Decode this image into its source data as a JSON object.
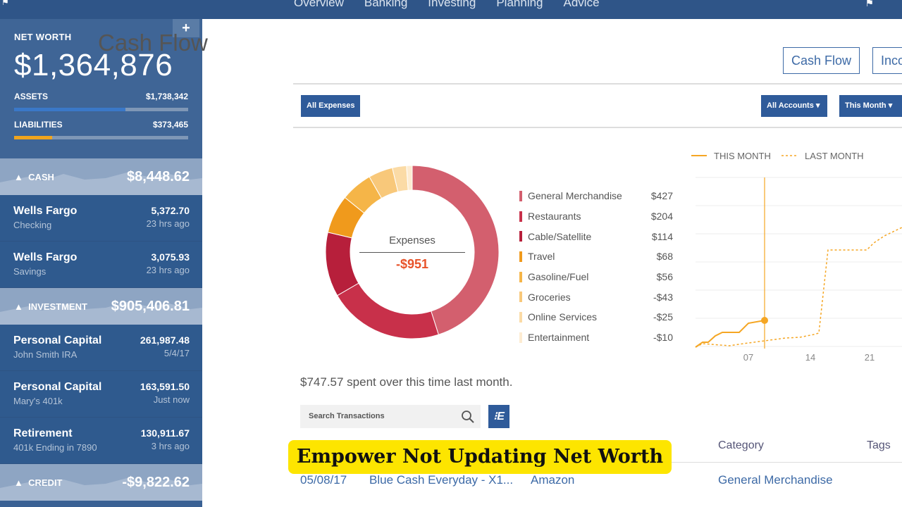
{
  "topnav": {
    "items": [
      "Overview",
      "Banking",
      "Investing",
      "Planning",
      "Advice"
    ]
  },
  "sidebar": {
    "net_worth_label": "NET WORTH",
    "net_worth": "$1,364,876",
    "assets_label": "ASSETS",
    "assets": "$1,738,342",
    "assets_fill": 0.64,
    "liabilities_label": "LIABILITIES",
    "liabilities": "$373,465",
    "liabilities_fill": 0.22,
    "sections": [
      {
        "title": "CASH",
        "total": "$8,448.62",
        "accounts": [
          {
            "name": "Wells Fargo",
            "sub": "Checking",
            "amount": "5,372.70",
            "updated": "23 hrs ago"
          },
          {
            "name": "Wells Fargo",
            "sub": "Savings",
            "amount": "3,075.93",
            "updated": "23 hrs ago"
          }
        ]
      },
      {
        "title": "INVESTMENT",
        "total": "$905,406.81",
        "accounts": [
          {
            "name": "Personal Capital",
            "sub": "John Smith IRA",
            "amount": "261,987.48",
            "updated": "5/4/17"
          },
          {
            "name": "Personal Capital",
            "sub": "Mary's 401k",
            "amount": "163,591.50",
            "updated": "Just now"
          },
          {
            "name": "Retirement",
            "sub": "401k Ending in 7890",
            "amount": "130,911.67",
            "updated": "3 hrs ago"
          }
        ]
      },
      {
        "title": "CREDIT",
        "total": "-$9,822.62",
        "accounts": []
      }
    ]
  },
  "main": {
    "title": "Cash Flow",
    "tabs": [
      "Cash Flow",
      "Inco"
    ],
    "filter": "All Expenses",
    "accounts_dd": "All Accounts",
    "period_dd": "This Month",
    "donut": {
      "label": "Expenses",
      "total": "-$951"
    },
    "categories": [
      {
        "name": "General Merchandise",
        "amount": "$427",
        "value": 427,
        "color": "#d35f6e"
      },
      {
        "name": "Restaurants",
        "amount": "$204",
        "value": 204,
        "color": "#c8304a"
      },
      {
        "name": "Cable/Satellite",
        "amount": "$114",
        "value": 114,
        "color": "#b71f3b"
      },
      {
        "name": "Travel",
        "amount": "$68",
        "value": 68,
        "color": "#f09a1c"
      },
      {
        "name": "Gasoline/Fuel",
        "amount": "$56",
        "value": 56,
        "color": "#f5b548"
      },
      {
        "name": "Groceries",
        "amount": "-$43",
        "value": 43,
        "color": "#f8c87a"
      },
      {
        "name": "Online Services",
        "amount": "-$25",
        "value": 25,
        "color": "#fbdba6"
      },
      {
        "name": "Entertainment",
        "amount": "-$10",
        "value": 10,
        "color": "#fdecd2"
      }
    ],
    "chart": {
      "legend": [
        "THIS MONTH",
        "LAST MONTH"
      ],
      "xticks": [
        "07",
        "14",
        "21"
      ],
      "color": "#f5a623"
    },
    "footnote": "$747.57 spent over this time last month.",
    "search_placeholder": "Search Transactions",
    "columns": [
      "Category",
      "Tags"
    ],
    "row": {
      "date": "05/08/17",
      "description": "Blue Cash Everyday - X1...",
      "merchant": "Amazon",
      "category": "General Merchandise"
    }
  },
  "banner": "Empower Not Updating Net Worth"
}
